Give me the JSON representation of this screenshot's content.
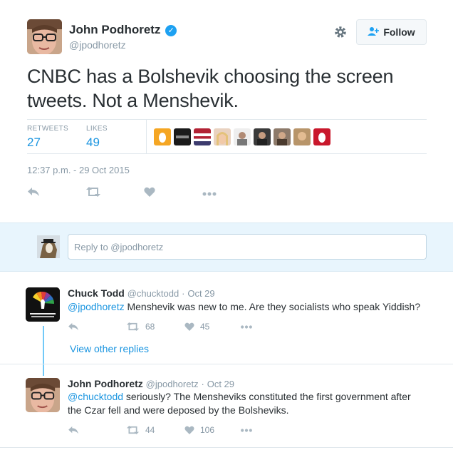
{
  "tweet": {
    "author_name": "John Podhoretz",
    "author_handle": "@jpodhoretz",
    "follow_label": "Follow",
    "text": "CNBC has a Bolshevik choosing the screen tweets. Not a Menshevik.",
    "stats": {
      "retweets_label": "RETWEETS",
      "retweets": "27",
      "likes_label": "LIKES",
      "likes": "49"
    },
    "timestamp": "12:37 p.m. - 29 Oct 2015"
  },
  "reply_box": {
    "placeholder": "Reply to @jpodhoretz"
  },
  "replies": [
    {
      "name": "Chuck Todd",
      "handle": "@chucktodd",
      "date": "Oct 29",
      "mention": "@jpodhoretz",
      "text": " Menshevik was new to me. Are they socialists who speak Yiddish?",
      "retweets": "68",
      "likes": "45"
    },
    {
      "name": "John Podhoretz",
      "handle": "@jpodhoretz",
      "date": "Oct 29",
      "mention": "@chucktodd",
      "text": " seriously? The Mensheviks constituted the first government after the Czar fell and were deposed by the Bolsheviks.",
      "retweets": "44",
      "likes": "106"
    }
  ],
  "view_other_replies": "View other replies",
  "separator": "·",
  "colors": {
    "accent": "#1da1f2",
    "link": "#1b95e0",
    "reply_bar_bg": "#e8f5fd",
    "thread_line": "#71c9f8"
  },
  "icons": {
    "verified": "verified-badge-icon",
    "gear": "gear-icon",
    "follow": "add-user-icon",
    "reply": "reply-icon",
    "retweet": "retweet-icon",
    "like": "heart-icon",
    "more": "more-icon"
  }
}
